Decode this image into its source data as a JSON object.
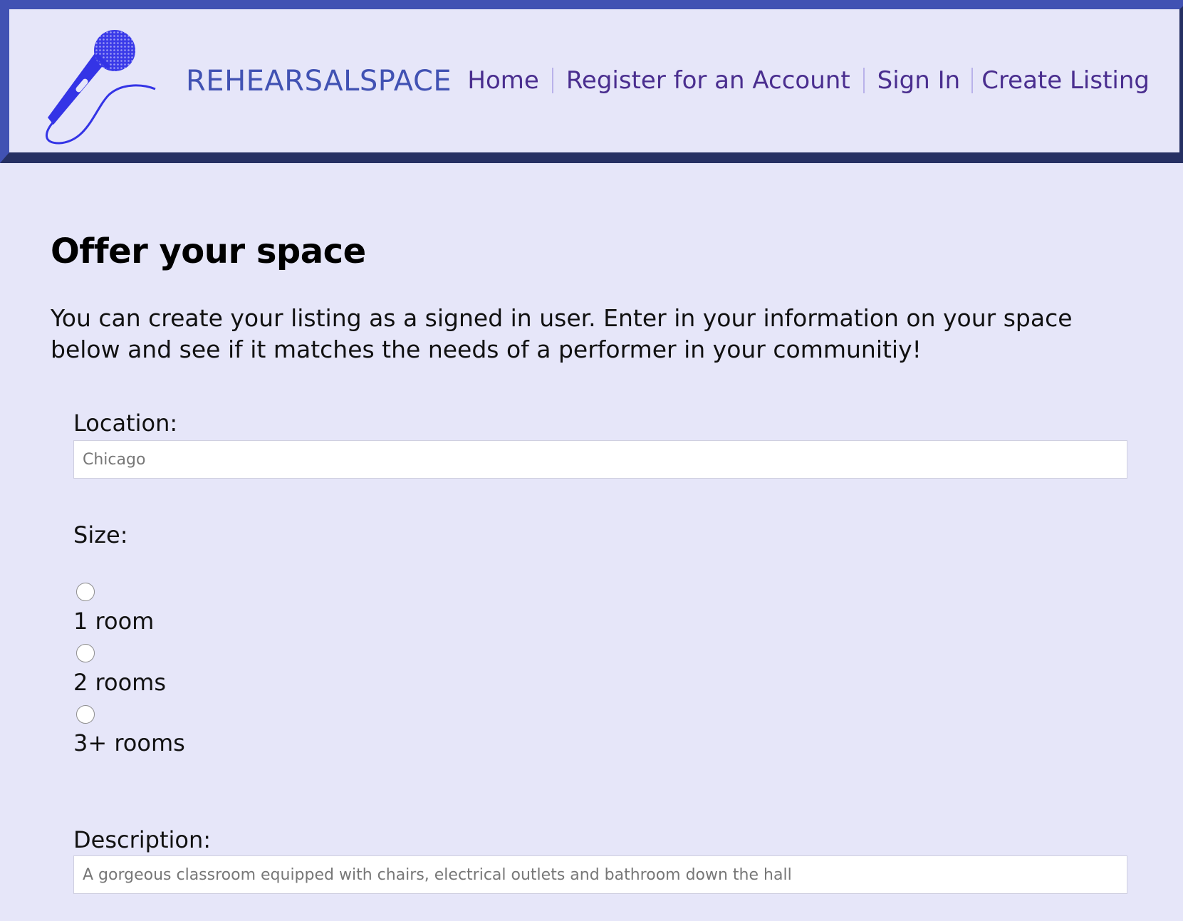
{
  "header": {
    "brand": "REHEARSALSPACE",
    "nav": [
      {
        "label": "Home"
      },
      {
        "label": "Register for an Account"
      },
      {
        "label": "Sign In"
      },
      {
        "label": "Create Listing"
      }
    ]
  },
  "main": {
    "title": "Offer your space",
    "intro": "You can create your listing as a signed in user. Enter in your information on your space below and see if it matches the needs of a performer in your communitiy!"
  },
  "form": {
    "location": {
      "label": "Location:",
      "placeholder": "Chicago"
    },
    "size": {
      "label": "Size:",
      "options": [
        {
          "label": "1 room",
          "selected": false
        },
        {
          "label": "2 rooms",
          "selected": false
        },
        {
          "label": "3+ rooms",
          "selected": false
        }
      ]
    },
    "description": {
      "label": "Description:",
      "placeholder": "A gorgeous classroom equipped with chairs, electrical outlets and bathroom down the hall"
    }
  },
  "colors": {
    "background": "#e6e6f9",
    "header_border_light": "#4152b3",
    "header_border_dark": "#263063",
    "brand": "#4152b3",
    "nav_link": "#4a2e8f",
    "microphone": "#3434e6"
  }
}
